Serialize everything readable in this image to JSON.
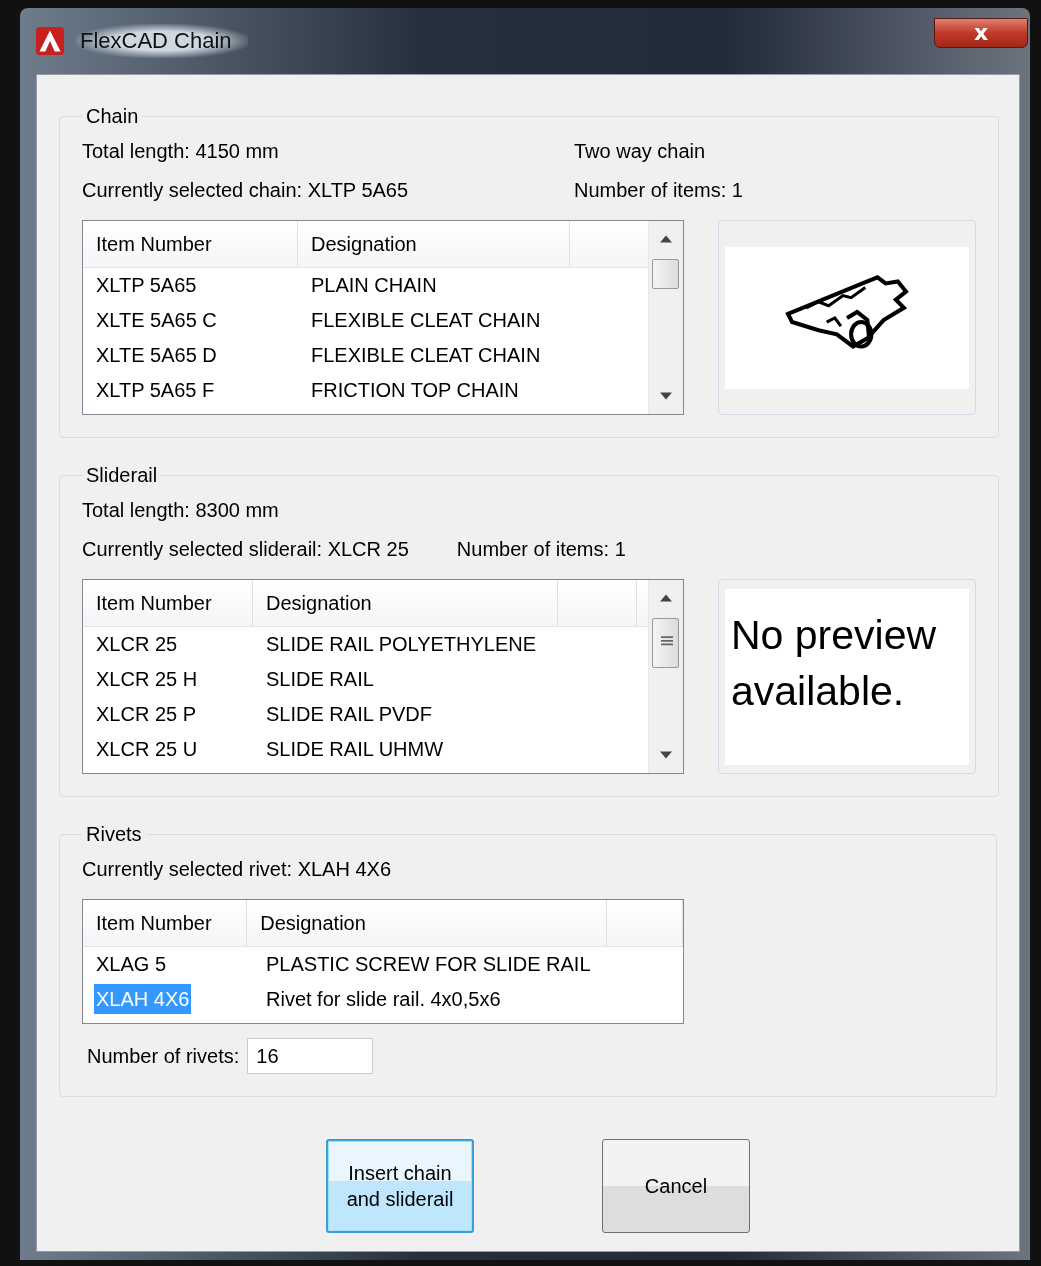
{
  "window": {
    "title": "FlexCAD Chain",
    "close": "x"
  },
  "sections": [
    {
      "legend": "Chain",
      "info": [
        [
          "Total length: 4150 mm",
          "Two way chain"
        ],
        [
          "Currently selected chain: XLTP 5A65",
          "Number of items: 1"
        ]
      ],
      "list": {
        "columns": [
          "Item Number",
          "Designation"
        ],
        "scrollbar": true,
        "rows": [
          {
            "item_number": "XLTP 5A65",
            "designation": "PLAIN CHAIN",
            "selected": false
          },
          {
            "item_number": "XLTE 5A65 C",
            "designation": "FLEXIBLE CLEAT CHAIN",
            "selected": false
          },
          {
            "item_number": "XLTE 5A65 D",
            "designation": "FLEXIBLE CLEAT CHAIN",
            "selected": false
          },
          {
            "item_number": "XLTP 5A65 F",
            "designation": "FRICTION TOP CHAIN",
            "selected": false
          }
        ]
      },
      "preview": {
        "kind": "picture"
      }
    },
    {
      "legend": "Sliderail",
      "info": [
        [
          "Total length: 8300 mm"
        ],
        [
          "Currently selected sliderail: XLCR 25",
          "Number of items: 1"
        ]
      ],
      "list": {
        "columns": [
          "Item Number",
          "Designation"
        ],
        "scrollbar": true,
        "rows": [
          {
            "item_number": "XLCR 25",
            "designation": "SLIDE RAIL POLYETHYLENE",
            "selected": false
          },
          {
            "item_number": "XLCR 25 H",
            "designation": "SLIDE RAIL",
            "selected": false
          },
          {
            "item_number": "XLCR 25 P",
            "designation": "SLIDE RAIL PVDF",
            "selected": false
          },
          {
            "item_number": "XLCR 25 U",
            "designation": "SLIDE RAIL UHMW",
            "selected": false
          }
        ]
      },
      "preview": {
        "kind": "message",
        "text": "No preview available."
      }
    },
    {
      "legend": "Rivets",
      "info": [
        [
          "Currently selected rivet: XLAH 4X6"
        ]
      ],
      "list": {
        "columns": [
          "Item Number",
          "Designation"
        ],
        "scrollbar": false,
        "rows": [
          {
            "item_number": "XLAG 5",
            "designation": "PLASTIC SCREW FOR SLIDE RAIL",
            "selected": false
          },
          {
            "item_number": "XLAH 4X6",
            "designation": "Rivet for slide rail. 4x0,5x6",
            "selected": true
          }
        ]
      },
      "field": {
        "label": "Number of rivets:",
        "value": "16"
      }
    }
  ],
  "buttons": [
    {
      "label": "Insert chain and sliderail",
      "default": true
    },
    {
      "label": "Cancel",
      "default": false
    }
  ]
}
